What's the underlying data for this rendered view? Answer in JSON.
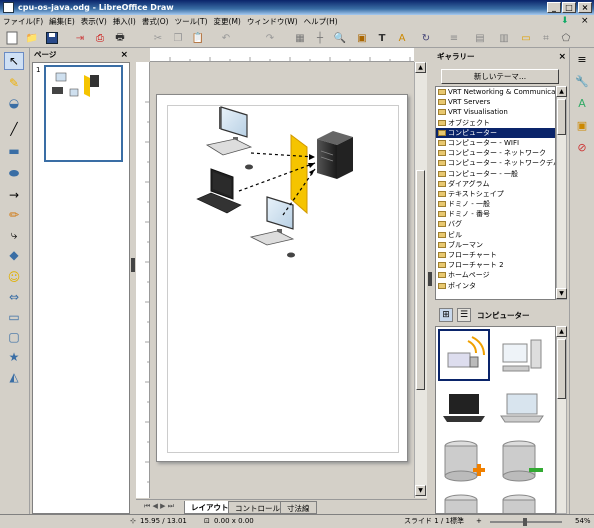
{
  "window": {
    "title": "cpu-os-java.odg - LibreOffice Draw",
    "minimize": "_",
    "maximize": "□",
    "close": "×"
  },
  "menu": [
    "ファイル(F)",
    "編集(E)",
    "表示(V)",
    "挿入(I)",
    "書式(O)",
    "ツール(T)",
    "変更(M)",
    "ウィンドウ(W)",
    "ヘルプ(H)"
  ],
  "pages_panel": {
    "title": "ページ",
    "close": "×",
    "page_number": "1"
  },
  "gallery_panel": {
    "title": "ギャラリー",
    "close": "×",
    "new_theme_button": "新しいテーマ...",
    "themes": [
      "VRT Networking & Communications",
      "VRT Servers",
      "VRT Visualisation",
      "オブジェクト",
      "コンピューター",
      "コンピューター - WIFI",
      "コンピューター - ネットワーク",
      "コンピューター - ネットワークデバイス",
      "コンピューター - 一般",
      "ダイアグラム",
      "テキストシェイプ",
      "ドミノ - 一般",
      "ドミノ - 番号",
      "バグ",
      "ビル",
      "ブルーマン",
      "フローチャート",
      "フローチャート 2",
      "ホームページ",
      "ポインタ"
    ],
    "selected_theme": "コンピューター",
    "current_theme_label": "コンピューター"
  },
  "tabs": [
    "レイアウト",
    "コントロール",
    "寸法線"
  ],
  "active_tab": "レイアウト",
  "status": {
    "position": "15.95 / 13.01",
    "size": "0.00 x 0.00",
    "slide": "スライド 1 / 1",
    "layout": "標準",
    "zoom": "54%"
  }
}
